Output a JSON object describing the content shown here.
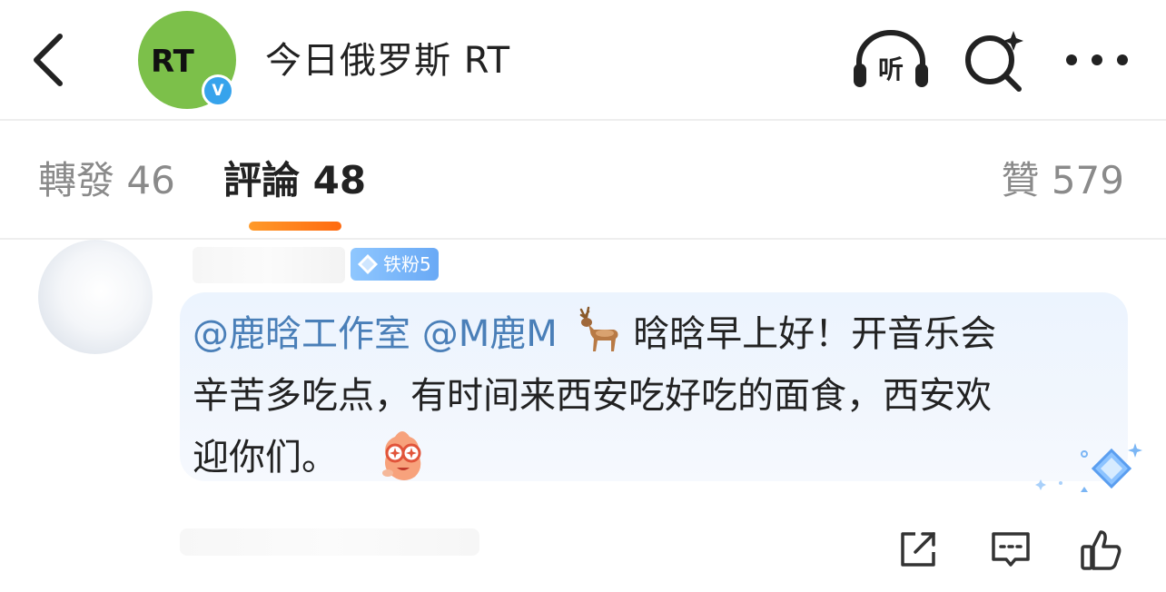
{
  "header": {
    "back_icon": "chevron-left-icon",
    "avatar_logo_text": "RT",
    "verified_mark": "V",
    "account_name": "今日俄罗斯 RT",
    "listen_label": "听",
    "actions": [
      "listen-icon",
      "search-icon",
      "more-icon"
    ]
  },
  "tabs": {
    "repost_label": "轉發",
    "repost_count": "46",
    "comment_label": "評論",
    "comment_count": "48",
    "like_label": "贊",
    "like_count": "579",
    "active": "comment"
  },
  "comment": {
    "fan_badge": "铁粉5",
    "mention_1": "@鹿晗工作室",
    "mention_2": "@M鹿M",
    "line_1_rest": "晗晗早上好！开音乐会",
    "line_2": "辛苦多吃点，有时间来西安吃好吃的面食，西安欢",
    "line_3": "迎你们。",
    "emoji_1": "deer-icon",
    "emoji_2": "star-eyes-emoji-icon"
  },
  "actions": [
    "share-icon",
    "reply-icon",
    "like-icon"
  ],
  "colors": {
    "accent_orange": "#ff7a1a",
    "mention_blue": "#4a7fb8",
    "verified_blue": "#36a3ec",
    "avatar_green": "#7cc04a",
    "bubble_bg": "#eef5fe"
  }
}
